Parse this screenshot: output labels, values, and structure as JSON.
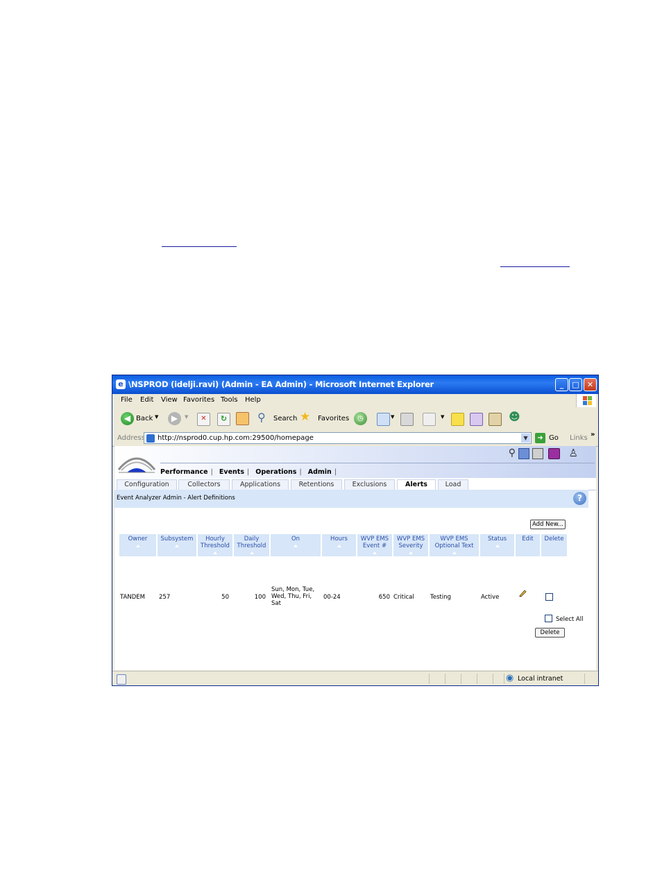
{
  "window": {
    "title": "\\NSPROD (idelji.ravi) (Admin - EA Admin) - Microsoft Internet Explorer",
    "controls": [
      "minimize",
      "maximize",
      "close"
    ]
  },
  "menu": [
    "File",
    "Edit",
    "View",
    "Favorites",
    "Tools",
    "Help"
  ],
  "toolbar": {
    "back_label": "Back",
    "search_label": "Search",
    "favorites_label": "Favorites"
  },
  "address": {
    "label": "Address",
    "url": "http://nsprod0.cup.hp.com:29500/homepage",
    "go_label": "Go",
    "links_label": "Links"
  },
  "nav": [
    "Performance",
    "Events",
    "Operations",
    "Admin"
  ],
  "tabs": [
    "Configuration",
    "Collectors",
    "Applications",
    "Retentions",
    "Exclusions",
    "Alerts",
    "Load"
  ],
  "active_tab": "Alerts",
  "breadcrumb": "Event Analyzer Admin - Alert Definitions",
  "add_new_label": "Add New...",
  "table": {
    "headers": [
      [
        "Owner"
      ],
      [
        "Subsystem"
      ],
      [
        "Hourly",
        "Threshold"
      ],
      [
        "Daily",
        "Threshold"
      ],
      [
        "On"
      ],
      [
        "Hours"
      ],
      [
        "WVP EMS",
        "Event #"
      ],
      [
        "WVP EMS",
        "Severity"
      ],
      [
        "WVP EMS",
        "Optional Text"
      ],
      [
        "Status"
      ],
      [
        "Edit"
      ],
      [
        "Delete"
      ]
    ],
    "rows": [
      {
        "owner": "TANDEM",
        "subsystem": "257",
        "hourly_threshold": "50",
        "daily_threshold": "100",
        "on": [
          "Sun, Mon, Tue,",
          "Wed, Thu, Fri,",
          "Sat"
        ],
        "hours": "00-24",
        "event_number": "650",
        "severity": "Critical",
        "optional_text": "Testing",
        "status": "Active"
      }
    ]
  },
  "select_all_label": "Select All",
  "delete_label": "Delete",
  "status": {
    "zone_label": "Local intranet"
  },
  "colors": {
    "title_bar": "#0a5de0",
    "header_cell": "#d7e6f8",
    "header_text": "#2c4fa8"
  }
}
